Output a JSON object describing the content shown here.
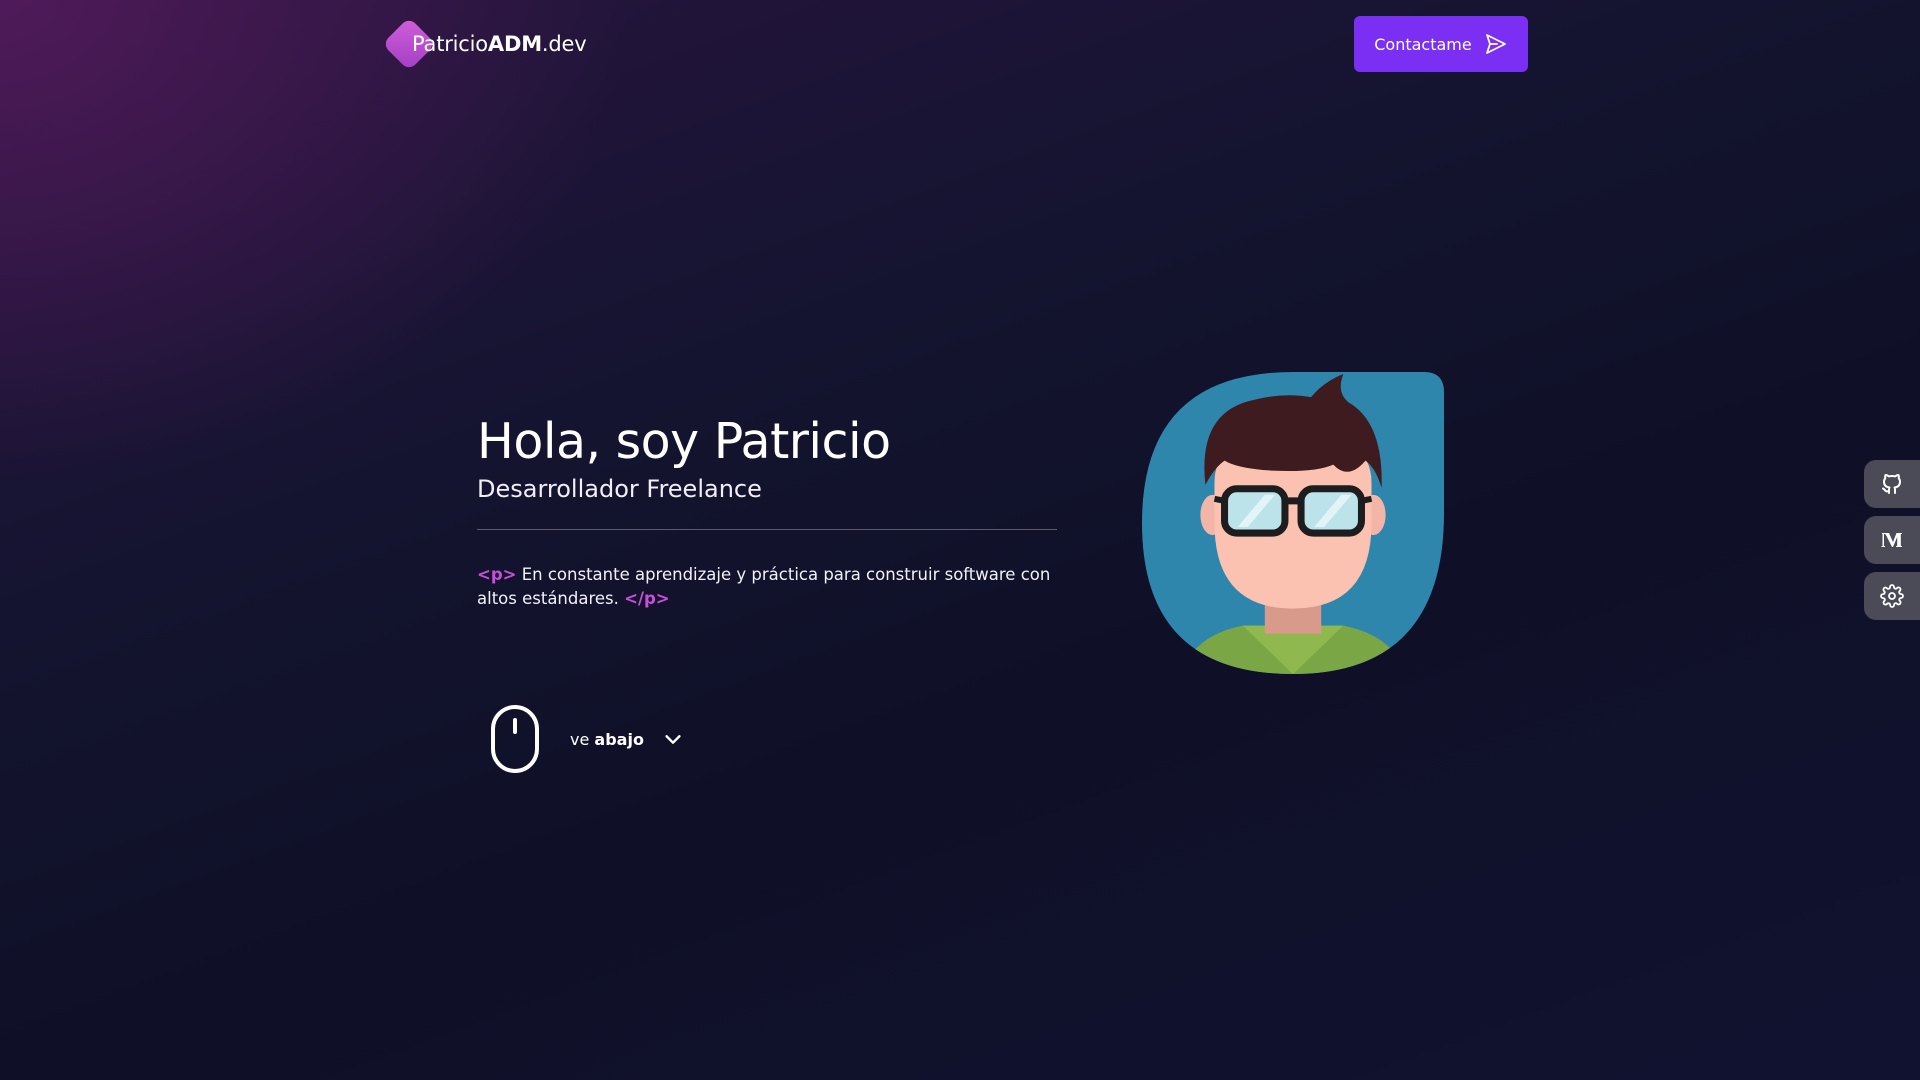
{
  "header": {
    "logo_prefix": "Patricio",
    "logo_bold": "ADM",
    "logo_suffix": ".dev",
    "contact_label": "Contactame"
  },
  "hero": {
    "title": "Hola, soy Patricio",
    "subtitle": "Desarrollador Freelance",
    "open_tag": "<p>",
    "description": "En constante aprendizaje y práctica para construir software con altos estándares.",
    "close_tag": "</p>"
  },
  "scroll_hint": {
    "prefix": "ve",
    "bold": "abajo"
  },
  "side_links": [
    {
      "icon": "github-icon"
    },
    {
      "icon": "medium-icon"
    },
    {
      "icon": "gear-icon"
    }
  ],
  "colors": {
    "accent": "#7b2ff2",
    "logo": "#d35fd9",
    "code_tag": "#c850d8",
    "avatar_bg": "#2e86ad",
    "background": "#0f1027"
  }
}
